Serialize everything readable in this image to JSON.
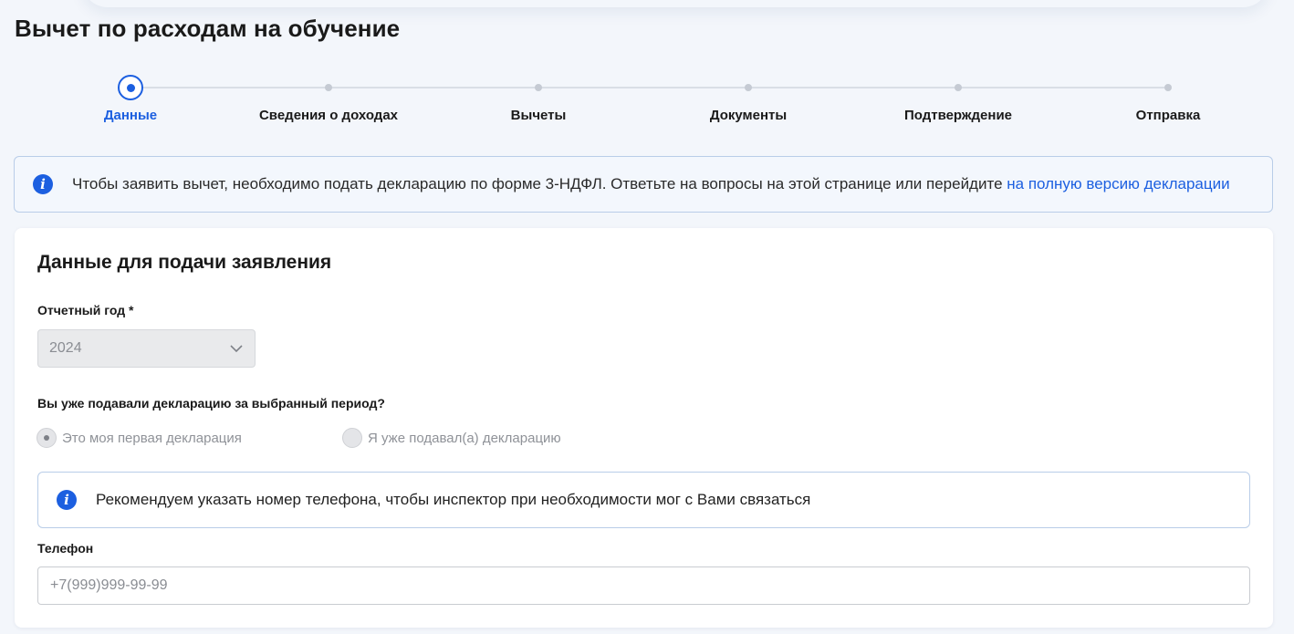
{
  "page": {
    "title": "Вычет по расходам на обучение"
  },
  "stepper": {
    "steps": [
      {
        "label": "Данные",
        "active": true
      },
      {
        "label": "Сведения о доходах",
        "active": false
      },
      {
        "label": "Вычеты",
        "active": false
      },
      {
        "label": "Документы",
        "active": false
      },
      {
        "label": "Подтверждение",
        "active": false
      },
      {
        "label": "Отправка",
        "active": false
      }
    ]
  },
  "banner": {
    "icon": "info-icon",
    "text": "Чтобы заявить вычет, необходимо подать декларацию по форме 3-НДФЛ. Ответьте на вопросы на этой странице или перейдите ",
    "link": "на полную версию декларации"
  },
  "form": {
    "title": "Данные для подачи заявления",
    "year_label": "Отчетный год *",
    "year_value": "2024",
    "question": "Вы уже подавали декларацию за выбранный период?",
    "radio_options": [
      {
        "label": "Это моя первая декларация",
        "checked": true
      },
      {
        "label": "Я уже подавал(а) декларацию",
        "checked": false
      }
    ],
    "phone_tip": "Рекомендуем указать номер телефона, чтобы инспектор при необходимости мог с Вами связаться",
    "phone_label": "Телефон",
    "phone_placeholder": "+7(999)999-99-99"
  },
  "colors": {
    "accent": "#1c5fe0",
    "background": "#f3f6fb",
    "border": "#b9cde8"
  }
}
